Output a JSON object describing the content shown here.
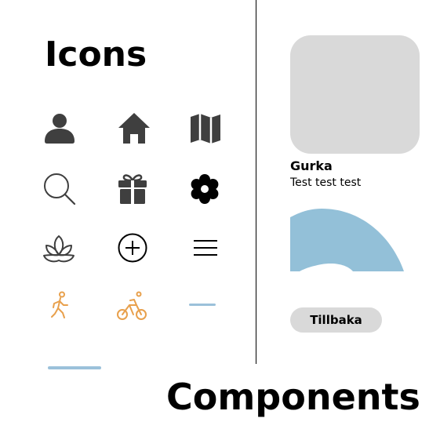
{
  "icons_section": {
    "title": "Icons",
    "icons": [
      "person-icon",
      "home-icon",
      "map-icon",
      "search-icon",
      "gift-icon",
      "flower-icon",
      "lotus-icon",
      "plus-circle-icon",
      "menu-icon",
      "walking-icon",
      "bike-icon",
      "dash-icon"
    ]
  },
  "components_section": {
    "title": "Components",
    "card": {
      "title": "Gurka",
      "text": "Test test test"
    },
    "back_button": {
      "label": "Tillbaka"
    }
  },
  "colors": {
    "icon_dark": "#3f3f3f",
    "accent_orange": "#e8a04c",
    "accent_blue": "#9bc1da",
    "placeholder_gray": "#d9d9d9"
  }
}
